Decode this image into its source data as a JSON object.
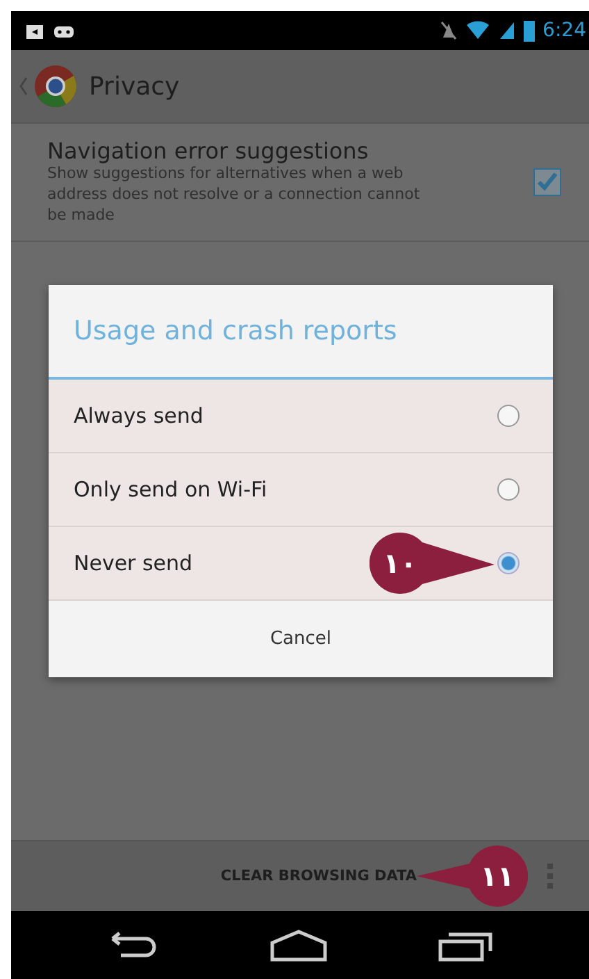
{
  "status_bar": {
    "time": "6:24"
  },
  "action_bar": {
    "title": "Privacy"
  },
  "settings": [
    {
      "title": "Navigation error suggestions",
      "summary": "Show suggestions for alternatives when a web address does not resolve or a connection cannot be made",
      "checked": true
    }
  ],
  "dialog": {
    "title": "Usage and crash reports",
    "options": [
      {
        "label": "Always send",
        "selected": false
      },
      {
        "label": "Only send on Wi-Fi",
        "selected": false
      },
      {
        "label": "Never send",
        "selected": true,
        "callout": "١٠"
      }
    ],
    "cancel": "Cancel"
  },
  "bottom_bar": {
    "button": "CLEAR BROWSING DATA",
    "callout": "١١"
  }
}
